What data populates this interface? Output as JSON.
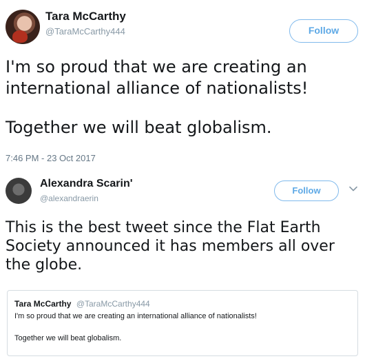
{
  "tweet": {
    "author_name": "Tara McCarthy",
    "author_handle": "@TaraMcCarthy444",
    "follow_label": "Follow",
    "text_lines": [
      "I'm so proud that we are creating an",
      "international alliance of nationalists!",
      "Together we will beat globalism."
    ],
    "timestamp": "7:46 PM - 23 Oct 2017"
  },
  "reply": {
    "author_name": "Alexandra Scarin'",
    "author_handle": "@alexandraerin",
    "follow_label": "Follow",
    "text_lines": [
      "This is the best tweet since the Flat Earth",
      "Society announced it has members all over",
      "the globe."
    ],
    "quoted": {
      "author_name": "Tara McCarthy",
      "author_handle": "@TaraMcCarthy444",
      "line1": "I'm so proud that we are creating an international alliance of nationalists!",
      "line2": "Together we will beat globalism."
    }
  },
  "colors": {
    "accent": "#5ea9e6",
    "muted": "#8899a6",
    "text": "#14171a"
  },
  "icons": [
    "chevron-down-icon"
  ]
}
